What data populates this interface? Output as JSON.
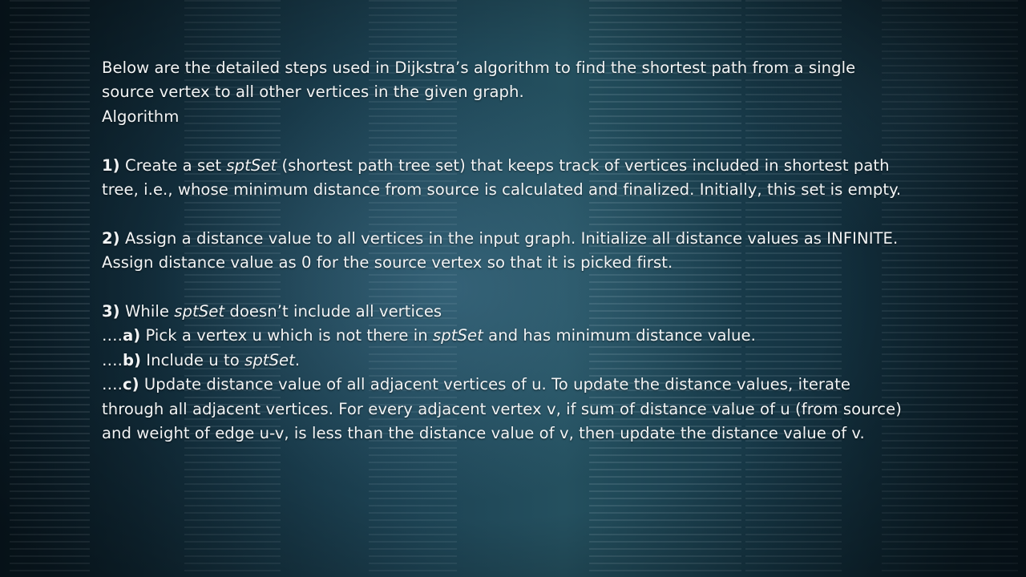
{
  "slide": {
    "intro": "Below are the detailed steps used in Dijkstra’s algorithm to find the shortest path from a single source vertex to all other vertices in the given graph.",
    "heading": "Algorithm",
    "step1": {
      "num": "1)",
      "pre": " Create a set ",
      "term": "sptSet",
      "post": " (shortest path tree set) that keeps track of vertices included in shortest path tree, i.e., whose minimum distance from source is calculated and finalized. Initially, this set is empty."
    },
    "step2": {
      "num": "2)",
      "text": " Assign a distance value to all vertices in the input graph. Initialize all distance values as INFINITE. Assign distance value as 0 for the source vertex so that it is picked first."
    },
    "step3": {
      "num": "3)",
      "pre": " While ",
      "term": "sptSet",
      "post": " doesn’t include all vertices",
      "a": {
        "dots": "….",
        "num": "a)",
        "pre": " Pick a vertex u which is not there in ",
        "term": "sptSet",
        "post": " and has minimum distance value."
      },
      "b": {
        "dots": "….",
        "num": "b)",
        "pre": " Include u to ",
        "term": "sptSet",
        "post": "."
      },
      "c": {
        "dots": "….",
        "num": "c)",
        "text": " Update distance value of all adjacent vertices of u. To update the distance values, iterate through all adjacent vertices. For every adjacent vertex v, if sum of distance value of u (from source) and weight of edge u-v, is less than the distance value of v, then update the distance value of v."
      }
    }
  }
}
